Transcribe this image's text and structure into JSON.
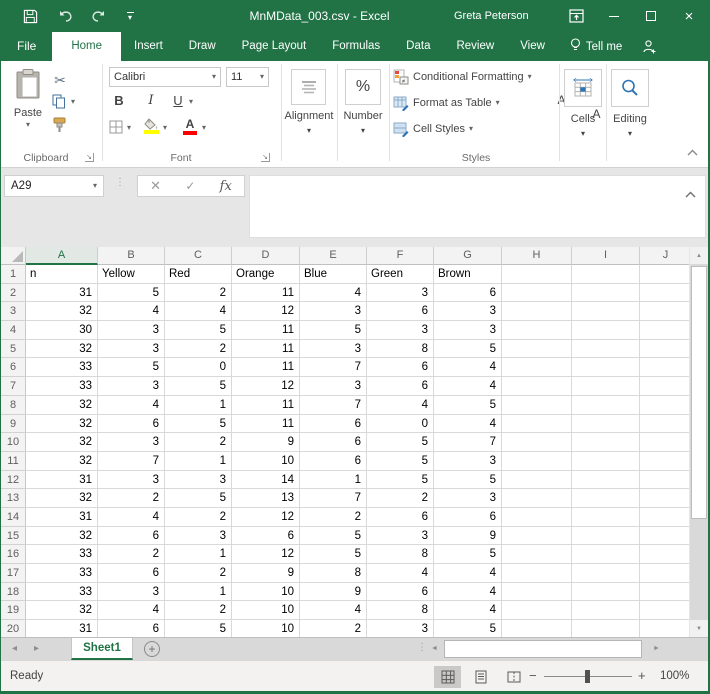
{
  "window": {
    "title": "MnMData_003.csv  -  Excel",
    "user": "Greta Peterson"
  },
  "tabs": {
    "file": "File",
    "items": [
      "Home",
      "Insert",
      "Draw",
      "Page Layout",
      "Formulas",
      "Data",
      "Review",
      "View"
    ],
    "active": "Home",
    "tell_me": "Tell me"
  },
  "ribbon": {
    "paste": "Paste",
    "font_name": "Calibri",
    "font_size": "11",
    "bold": "B",
    "italic": "I",
    "underline": "U",
    "grow_font": "A",
    "shrink_font": "A",
    "font_color_letter": "A",
    "alignment": "Alignment",
    "number": "Number",
    "percent": "%",
    "conditional_formatting": "Conditional Formatting",
    "format_as_table": "Format as Table",
    "cell_styles": "Cell Styles",
    "cells": "Cells",
    "editing": "Editing",
    "group_clipboard": "Clipboard",
    "group_font": "Font",
    "group_styles": "Styles"
  },
  "formula_bar": {
    "name_box": "A29",
    "fx": "fx",
    "cancel": "✕",
    "enter": "✓"
  },
  "grid": {
    "column_headers": [
      "A",
      "B",
      "C",
      "D",
      "E",
      "F",
      "G",
      "H",
      "I",
      "J"
    ],
    "active_column": "A",
    "header_row": [
      "n",
      "Yellow",
      "Red",
      "Orange",
      "Blue",
      "Green",
      "Brown"
    ],
    "rows": [
      [
        31,
        5,
        2,
        11,
        4,
        3,
        6
      ],
      [
        32,
        4,
        4,
        12,
        3,
        6,
        3
      ],
      [
        30,
        3,
        5,
        11,
        5,
        3,
        3
      ],
      [
        32,
        3,
        2,
        11,
        3,
        8,
        5
      ],
      [
        33,
        5,
        0,
        11,
        7,
        6,
        4
      ],
      [
        33,
        3,
        5,
        12,
        3,
        6,
        4
      ],
      [
        32,
        4,
        1,
        11,
        7,
        4,
        5
      ],
      [
        32,
        6,
        5,
        11,
        6,
        0,
        4
      ],
      [
        32,
        3,
        2,
        9,
        6,
        5,
        7
      ],
      [
        32,
        7,
        1,
        10,
        6,
        5,
        3
      ],
      [
        31,
        3,
        3,
        14,
        1,
        5,
        5
      ],
      [
        32,
        2,
        5,
        13,
        7,
        2,
        3
      ],
      [
        31,
        4,
        2,
        12,
        2,
        6,
        6
      ],
      [
        32,
        6,
        3,
        6,
        5,
        3,
        9
      ],
      [
        33,
        2,
        1,
        12,
        5,
        8,
        5
      ],
      [
        33,
        6,
        2,
        9,
        8,
        4,
        4
      ],
      [
        33,
        3,
        1,
        10,
        9,
        6,
        4
      ],
      [
        32,
        4,
        2,
        10,
        4,
        8,
        4
      ],
      [
        31,
        6,
        5,
        10,
        2,
        3,
        5
      ]
    ]
  },
  "sheet_bar": {
    "active_sheet": "Sheet1",
    "add_sheet": "+"
  },
  "status_bar": {
    "status": "Ready",
    "zoom_level": "100%"
  },
  "icons": {
    "dropdown": "▾",
    "scissors": "✂",
    "dots_vertical": "⋮",
    "prev_sheet": "◂",
    "next_sheet": "▸",
    "scroll_left": "◄",
    "scroll_right": "►",
    "scroll_up": "▲",
    "scroll_down": "▼",
    "close": "×",
    "minus": "−",
    "plus": "+"
  },
  "colors": {
    "excel_green": "#217346",
    "fill_yellow": "#ffff00",
    "font_red": "#ff0000"
  }
}
